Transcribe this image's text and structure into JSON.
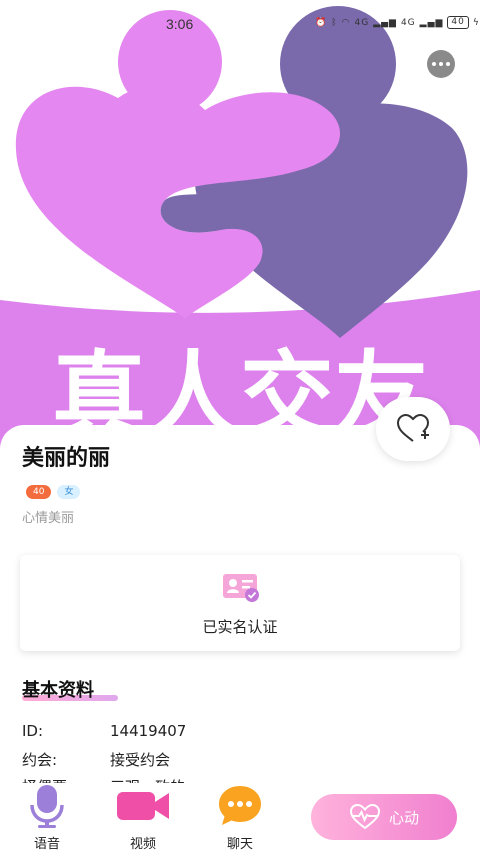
{
  "status_bar": {
    "time": "3:06",
    "network_left": "4G",
    "network_right": "4G",
    "battery": "40"
  },
  "hero": {
    "banner_text": "真人交友"
  },
  "profile": {
    "name": "美丽的丽",
    "age_tag": "40",
    "gender_tag": "女",
    "mood": "心情美丽"
  },
  "verification": {
    "label": "已实名认证"
  },
  "basic_info": {
    "title": "基本资料",
    "rows": [
      {
        "key": "ID:",
        "value": "14419407"
      },
      {
        "key": "约会:",
        "value": "接受约会"
      },
      {
        "key": "择偶要",
        "value": "三观一致的"
      }
    ]
  },
  "bottom_nav": {
    "voice_label": "语音",
    "video_label": "视频",
    "chat_label": "聊天",
    "heartbeat_label": "心动"
  },
  "colors": {
    "pink": "#e587f0",
    "purple": "#7a6aab",
    "banner_bg": "#dd82ec",
    "accent_orange": "#f36c3d"
  }
}
